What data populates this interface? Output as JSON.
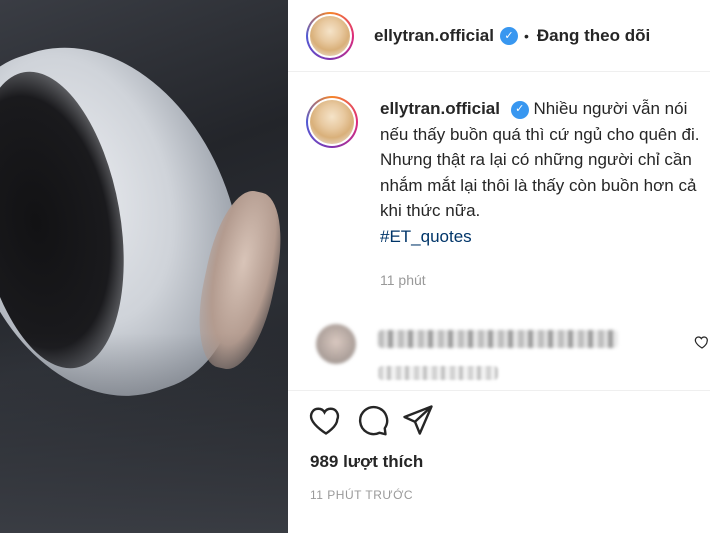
{
  "header": {
    "username": "ellytran.official",
    "separator": "•",
    "follow_status": "Đang theo dõi"
  },
  "caption": {
    "username": "ellytran.official",
    "text": "Nhiều người vẫn nói nếu thấy buồn quá thì cứ ngủ cho quên đi. Nhưng thật ra lại có những người chỉ cần nhắm mắt lại thôi là thấy còn buồn hơn cả khi thức nữa.",
    "hashtag": "#ET_quotes",
    "time": "11 phút"
  },
  "likes": "989 lượt thích",
  "posted_ago": "11 PHÚT TRƯỚC",
  "icons": {
    "verified": "verified-badge-icon",
    "like": "heart-icon",
    "comment": "comment-icon",
    "share": "send-icon"
  },
  "colors": {
    "verified": "#3897f0",
    "hashtag": "#003569",
    "muted": "#999999"
  }
}
